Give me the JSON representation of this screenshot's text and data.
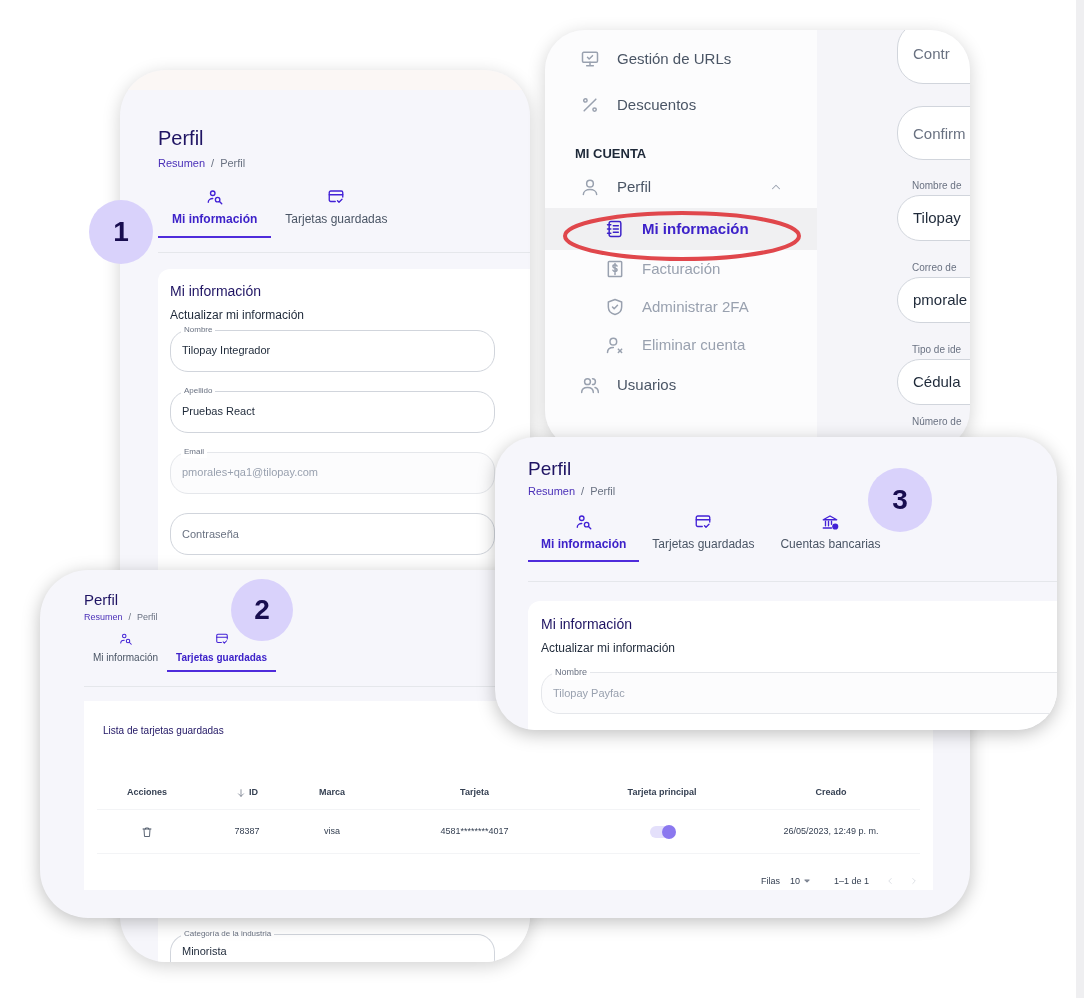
{
  "panel_1": {
    "badge": "1",
    "title": "Perfil",
    "breadcrumb": {
      "items": [
        "Resumen",
        "Perfil"
      ],
      "separator": "/"
    },
    "tabs": [
      {
        "label": "Mi información",
        "selected": true
      },
      {
        "label": "Tarjetas guardadas",
        "selected": false
      }
    ],
    "card": {
      "title": "Mi información",
      "subtitle": "Actualizar mi información",
      "fields": [
        {
          "label": "Nombre",
          "value": "Tilopay Integrador",
          "disabled": false
        },
        {
          "label": "Apellido",
          "value": "Pruebas React",
          "disabled": false
        },
        {
          "label": "Email",
          "value": "pmorales+qa1@tilopay.com",
          "disabled": true
        },
        {
          "placeholder": "Contraseña",
          "disabled": false
        }
      ],
      "lower_fields": [
        {
          "label": "Categoría de la industria",
          "value": "Minorista",
          "disabled": false
        }
      ]
    }
  },
  "navigation_panel": {
    "items": [
      {
        "label": "Gestión de URLs"
      },
      {
        "label": "Descuentos"
      }
    ],
    "section": "MI CUENTA",
    "account_items": [
      {
        "label": "Perfil",
        "expanded": true,
        "children": [
          {
            "label": "Mi información",
            "selected": true
          },
          {
            "label": "Facturación",
            "selected": false
          },
          {
            "label": "Administrar 2FA",
            "selected": false
          },
          {
            "label": "Eliminar cuenta",
            "selected": false
          }
        ]
      },
      {
        "label": "Usuarios"
      }
    ],
    "form_fields": [
      {
        "placeholder": "Contr"
      },
      {
        "placeholder": "Confirm"
      },
      {
        "label": "Nombre de",
        "value": "Tilopay"
      },
      {
        "label": "Correo de",
        "value": "pmorale"
      },
      {
        "label": "Tipo de ide",
        "value": "Cédula"
      },
      {
        "label": "Número de"
      }
    ]
  },
  "panel_2": {
    "badge": "2",
    "title": "Perfil",
    "breadcrumb": {
      "items": [
        "Resumen",
        "Perfil"
      ],
      "separator": "/"
    },
    "tabs": [
      {
        "label": "Mi información",
        "selected": false
      },
      {
        "label": "Tarjetas guardadas",
        "selected": true
      }
    ],
    "card": {
      "title": "Lista de tarjetas guardadas",
      "columns": [
        {
          "label": "Acciones",
          "sorted": false
        },
        {
          "label": "ID",
          "sorted": true
        },
        {
          "label": "Marca",
          "sorted": false
        },
        {
          "label": "Tarjeta",
          "sorted": false
        },
        {
          "label": "Tarjeta principal",
          "sorted": false
        },
        {
          "label": "Creado",
          "sorted": false
        }
      ],
      "rows": [
        {
          "id": "78387",
          "brand": "visa",
          "card": "4581********4017",
          "primary": true,
          "created": "26/05/2023, 12:49 p. m."
        }
      ],
      "pagination": {
        "rows_label": "Filas",
        "rows_per_page": "10",
        "range": "1–1 de 1",
        "previous_disabled": true,
        "next_disabled": true
      }
    }
  },
  "panel_3": {
    "badge": "3",
    "title": "Perfil",
    "breadcrumb": {
      "items": [
        "Resumen",
        "Perfil"
      ],
      "separator": "/"
    },
    "tabs": [
      {
        "label": "Mi información",
        "selected": true
      },
      {
        "label": "Tarjetas guardadas",
        "selected": false
      },
      {
        "label": "Cuentas bancarias",
        "selected": false
      }
    ],
    "card": {
      "title": "Mi información",
      "subtitle": "Actualizar mi información",
      "fields": [
        {
          "label": "Nombre",
          "value": "Tilopay Payfac",
          "disabled": true
        }
      ]
    }
  }
}
